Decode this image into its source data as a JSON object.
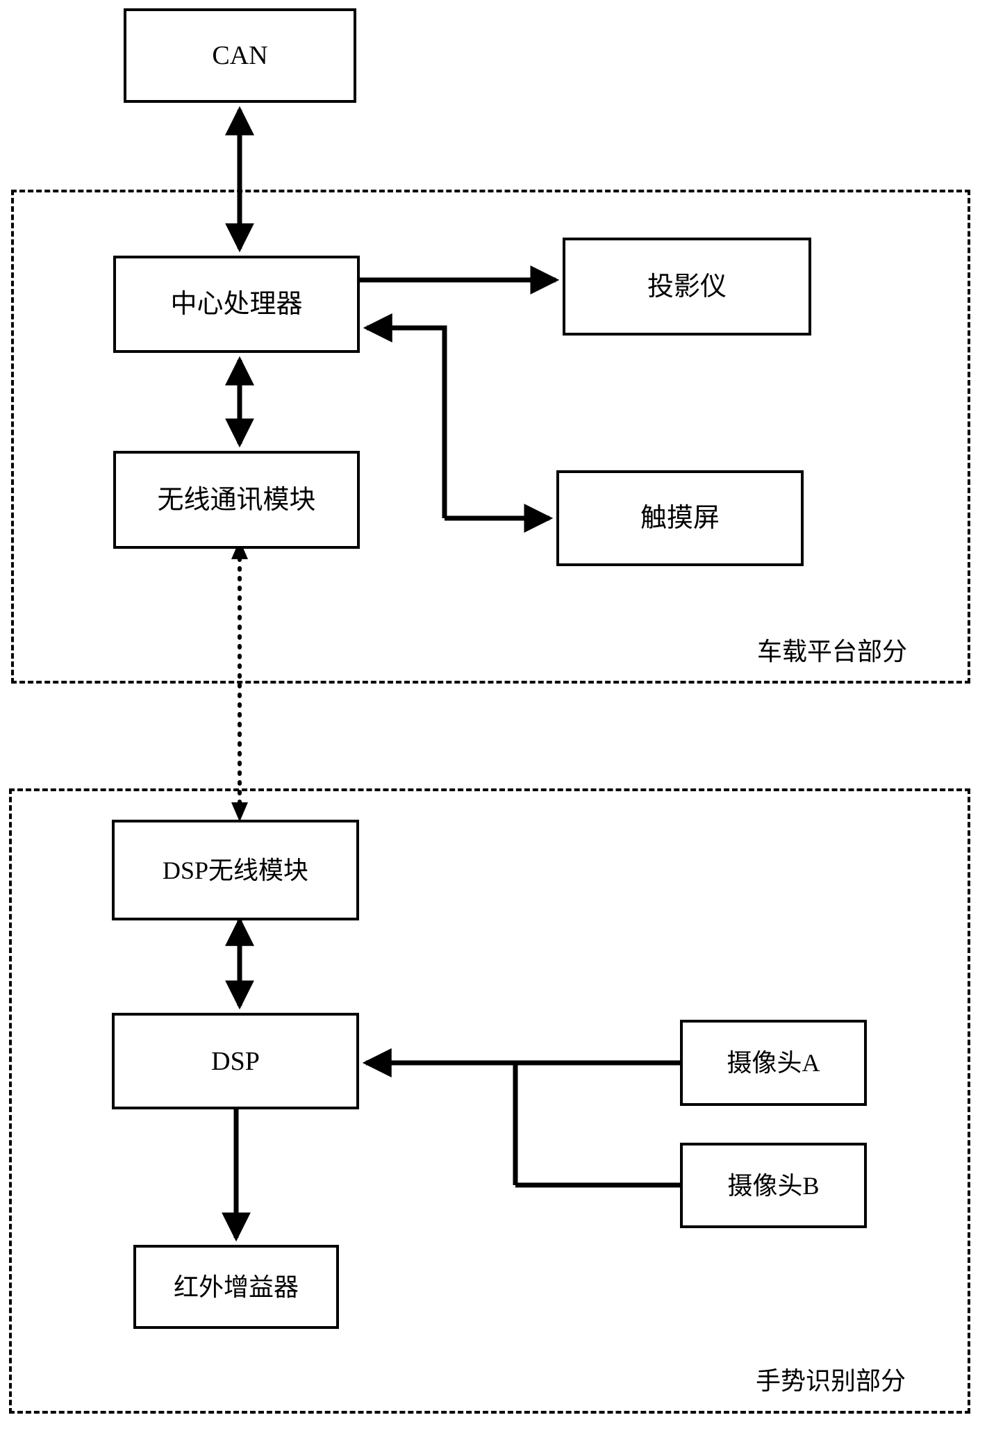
{
  "diagram": {
    "regions": [
      {
        "id": "vehicle-platform",
        "label": "车载平台部分"
      },
      {
        "id": "gesture-recognition",
        "label": "手势识别部分"
      }
    ],
    "nodes": {
      "can": "CAN",
      "central_processor": "中心处理器",
      "projector": "投影仪",
      "wireless_module": "无线通讯模块",
      "touchscreen": "触摸屏",
      "dsp_wireless_module": "DSP无线模块",
      "dsp": "DSP",
      "camera_a": "摄像头A",
      "camera_b": "摄像头B",
      "infrared_amplifier": "红外增益器"
    }
  }
}
